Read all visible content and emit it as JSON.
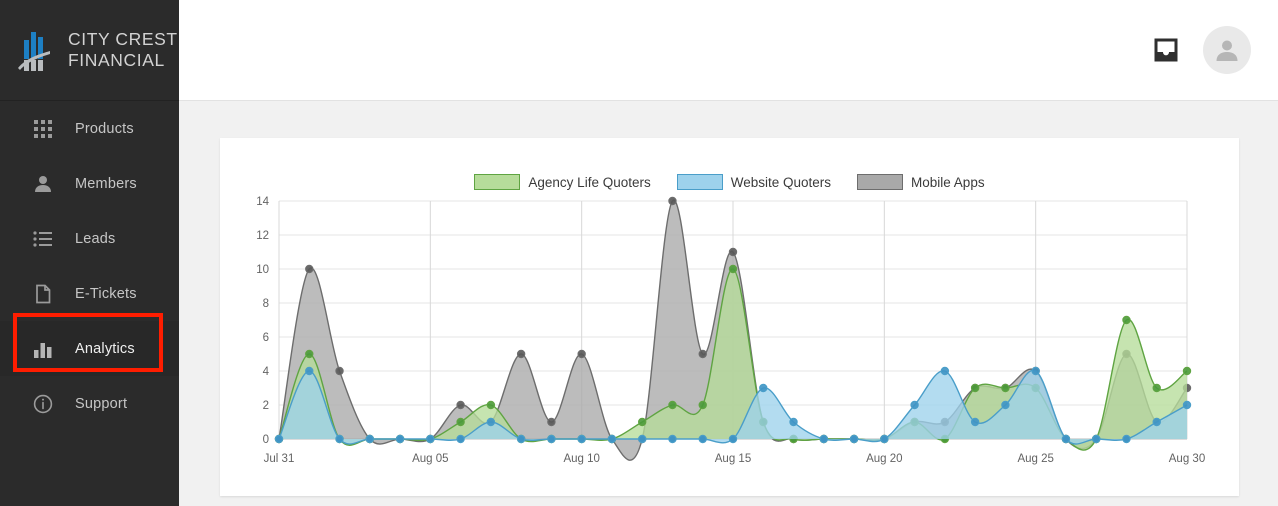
{
  "brand": {
    "line1": "CITY CREST",
    "line2": "FINANCIAL",
    "logo_icon": "bar-chart-logo-icon",
    "blue": "#1d7fc3",
    "gray": "#b9bcbe"
  },
  "sidebar": {
    "items": [
      {
        "label": "Products",
        "icon": "grid-icon",
        "active": false
      },
      {
        "label": "Members",
        "icon": "person-icon",
        "active": false
      },
      {
        "label": "Leads",
        "icon": "list-icon",
        "active": false
      },
      {
        "label": "E-Tickets",
        "icon": "document-icon",
        "active": false
      },
      {
        "label": "Analytics",
        "icon": "bar-chart-icon",
        "active": true
      },
      {
        "label": "Support",
        "icon": "info-icon",
        "active": false
      }
    ],
    "highlight_color": "#ff1d00",
    "highlighted_item": "Analytics"
  },
  "topbar": {
    "inbox_icon": "inbox-tray-icon",
    "avatar_icon": "user-avatar-icon"
  },
  "chart_data": {
    "type": "area",
    "title": "",
    "xlabel": "",
    "ylabel": "",
    "ylim": [
      0,
      14
    ],
    "yticks": [
      0,
      2,
      4,
      6,
      8,
      10,
      12,
      14
    ],
    "grid": true,
    "legend_position": "top-center",
    "x": [
      "Jul 31",
      "Aug 01",
      "Aug 02",
      "Aug 03",
      "Aug 04",
      "Aug 05",
      "Aug 06",
      "Aug 07",
      "Aug 08",
      "Aug 09",
      "Aug 10",
      "Aug 11",
      "Aug 12",
      "Aug 13",
      "Aug 14",
      "Aug 15",
      "Aug 16",
      "Aug 17",
      "Aug 18",
      "Aug 19",
      "Aug 20",
      "Aug 21",
      "Aug 22",
      "Aug 23",
      "Aug 24",
      "Aug 25",
      "Aug 26",
      "Aug 27",
      "Aug 28",
      "Aug 29",
      "Aug 30"
    ],
    "xticklabels": [
      "Jul 31",
      "Aug 05",
      "Aug 10",
      "Aug 15",
      "Aug 20",
      "Aug 25",
      "Aug 30"
    ],
    "xtick_indices": [
      0,
      5,
      10,
      15,
      20,
      25,
      30
    ],
    "series": [
      {
        "name": "Agency Life Quoters",
        "fill": "#b6dc9a",
        "stroke": "#5fa442",
        "point": "#4a9a3a",
        "values": [
          0,
          5,
          0,
          0,
          0,
          0,
          1,
          2,
          0,
          0,
          0,
          0,
          1,
          2,
          2,
          10,
          1,
          0,
          0,
          0,
          0,
          1,
          0,
          3,
          3,
          3,
          0,
          0,
          7,
          3,
          4,
          0
        ]
      },
      {
        "name": "Website Quoters",
        "fill": "#9ed2ec",
        "stroke": "#4a9ec9",
        "point": "#3f93c4",
        "values": [
          0,
          4,
          0,
          0,
          0,
          0,
          0,
          1,
          0,
          0,
          0,
          0,
          0,
          0,
          0,
          0,
          3,
          1,
          0,
          0,
          0,
          2,
          4,
          1,
          2,
          4,
          0,
          0,
          0,
          1,
          2,
          0
        ]
      },
      {
        "name": "Mobile Apps",
        "fill": "#a9a9a9",
        "stroke": "#6d6d6d",
        "point": "#585858",
        "values": [
          0,
          10,
          4,
          0,
          0,
          0,
          2,
          1,
          5,
          1,
          5,
          0,
          0,
          14,
          5,
          11,
          1,
          0,
          0,
          0,
          0,
          1,
          1,
          3,
          3,
          4,
          0,
          0,
          5,
          1,
          3,
          0
        ]
      }
    ]
  }
}
